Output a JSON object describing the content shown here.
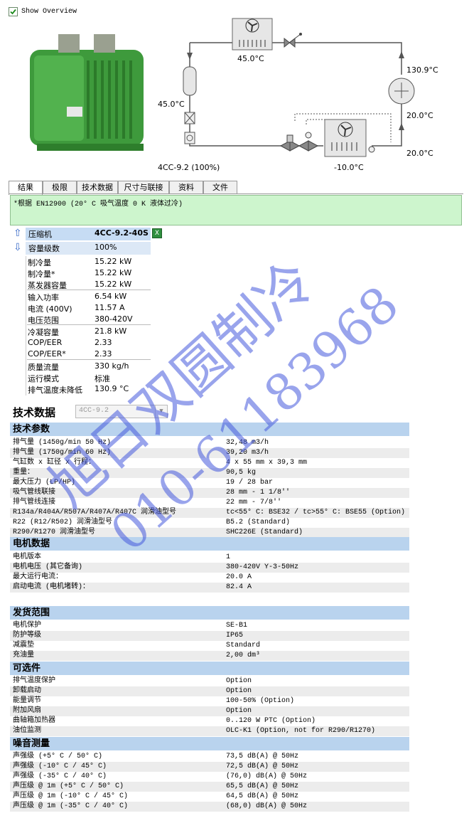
{
  "show_overview": {
    "label": "Show Overview",
    "checked": true
  },
  "diagram": {
    "condenser_temp": "45.0°C",
    "discharge_temp": "130.9°C",
    "liquid_temp": "45.0°C",
    "suction_temp_1": "20.0°C",
    "suction_temp_2": "20.0°C",
    "evap_temp": "-10.0°C",
    "model_label": "4CC-9.2 (100%)"
  },
  "tabs": [
    "结果",
    "极限",
    "技术数据",
    "尺寸与联接",
    "资料",
    "文件"
  ],
  "note": "*根据 EN12900 (20° C 吸气温度 0 K 液体过冷)",
  "results": {
    "compressor_label": "压缩机",
    "compressor_value": "4CC-9.2-40S",
    "capacity_step_label": "容量级数",
    "capacity_step_value": "100%",
    "rows": [
      {
        "label": "制冷量",
        "value": "15.22 kW"
      },
      {
        "label": "制冷量*",
        "value": "15.22 kW"
      },
      {
        "label": "蒸发器容量",
        "value": "15.22 kW"
      },
      {
        "label": "输入功率",
        "value": "6.54 kW"
      },
      {
        "label": "电流 (400V)",
        "value": "11.57 A"
      },
      {
        "label": "电压范围",
        "value": "380-420V"
      },
      {
        "label": "冷凝容量",
        "value": "21.8 kW"
      },
      {
        "label": "COP/EER",
        "value": "2.33"
      },
      {
        "label": "COP/EER*",
        "value": "2.33"
      },
      {
        "label": "质量流量",
        "value": "330 kg/h"
      },
      {
        "label": "运行模式",
        "value": "标准"
      },
      {
        "label": "排气温度未降低",
        "value": "130.9 °C"
      }
    ]
  },
  "techdata": {
    "title": "技术数据",
    "select_value": "4CC-9.2",
    "sections": [
      {
        "title": "技术参数",
        "rows": [
          {
            "k": "排气量 (1450g/min 50 Hz)",
            "v": "32,48 m3/h"
          },
          {
            "k": "排气量 (1750g/min 60 Hz)",
            "v": "39,20 m3/h"
          },
          {
            "k": "气缸数 x 缸径 x 行程：",
            "v": "4 x 55 mm x 39,3 mm"
          },
          {
            "k": "重量：",
            "v": "90,5 kg"
          },
          {
            "k": "最大压力 (LP/HP)",
            "v": "19 / 28 bar"
          },
          {
            "k": "吸气管线联接",
            "v": "28 mm - 1 1/8''"
          },
          {
            "k": "排气管线连接",
            "v": "22 mm - 7/8''"
          },
          {
            "k": "R134a/R404A/R507A/R407A/R407C 润滑油型号",
            "v": "tc<55° C: BSE32 / tc>55° C: BSE55 (Option)"
          },
          {
            "k": "R22 (R12/R502) 润滑油型号",
            "v": "B5.2 (Standard)"
          },
          {
            "k": "R290/R1270 润滑油型号",
            "v": "SHC226E (Standard)"
          }
        ]
      },
      {
        "title": "电机数据",
        "rows": [
          {
            "k": "电机版本",
            "v": "1"
          },
          {
            "k": "电机电压 (其它备询)",
            "v": "380-420V Y-3-50Hz"
          },
          {
            "k": "最大运行电流：",
            "v": "20.0 A"
          },
          {
            "k": "启动电流 (电机堵转)：",
            "v": "82.4 A"
          }
        ]
      },
      {
        "title": "发货范围",
        "rows": [
          {
            "k": "电机保护",
            "v": "SE-B1"
          },
          {
            "k": "防护等级",
            "v": "IP65"
          },
          {
            "k": "减震垫",
            "v": "Standard"
          },
          {
            "k": "充油量",
            "v": "2,00 dm³"
          }
        ]
      },
      {
        "title": "可选件",
        "rows": [
          {
            "k": "排气温度保护",
            "v": "Option"
          },
          {
            "k": "卸载启动",
            "v": "Option"
          },
          {
            "k": "能量调节",
            "v": "100-50% (Option)"
          },
          {
            "k": "附加风扇",
            "v": "Option"
          },
          {
            "k": "曲轴箱加热器",
            "v": "0..120 W PTC (Option)"
          },
          {
            "k": "油位监测",
            "v": "OLC-K1 (Option, not for R290/R1270)"
          }
        ]
      },
      {
        "title": "噪音测量",
        "rows": [
          {
            "k": "声强级 (+5° C / 50° C)",
            "v": "73,5 dB(A) @ 50Hz"
          },
          {
            "k": "声强级 (-10° C / 45° C)",
            "v": "72,5 dB(A) @ 50Hz"
          },
          {
            "k": "声强级 (-35° C / 40° C)",
            "v": "(76,0) dB(A) @ 50Hz"
          },
          {
            "k": "声压级 @ 1m (+5° C / 50° C)",
            "v": "65,5 dB(A) @ 50Hz"
          },
          {
            "k": "声压级 @ 1m (-10° C / 45° C)",
            "v": "64,5 dB(A) @ 50Hz"
          },
          {
            "k": "声压级 @ 1m (-35° C / 40° C)",
            "v": "(68,0) dB(A) @ 50Hz"
          }
        ]
      }
    ]
  },
  "watermark": {
    "line1": "旭日双圆制冷",
    "line2": "010-61183968"
  }
}
